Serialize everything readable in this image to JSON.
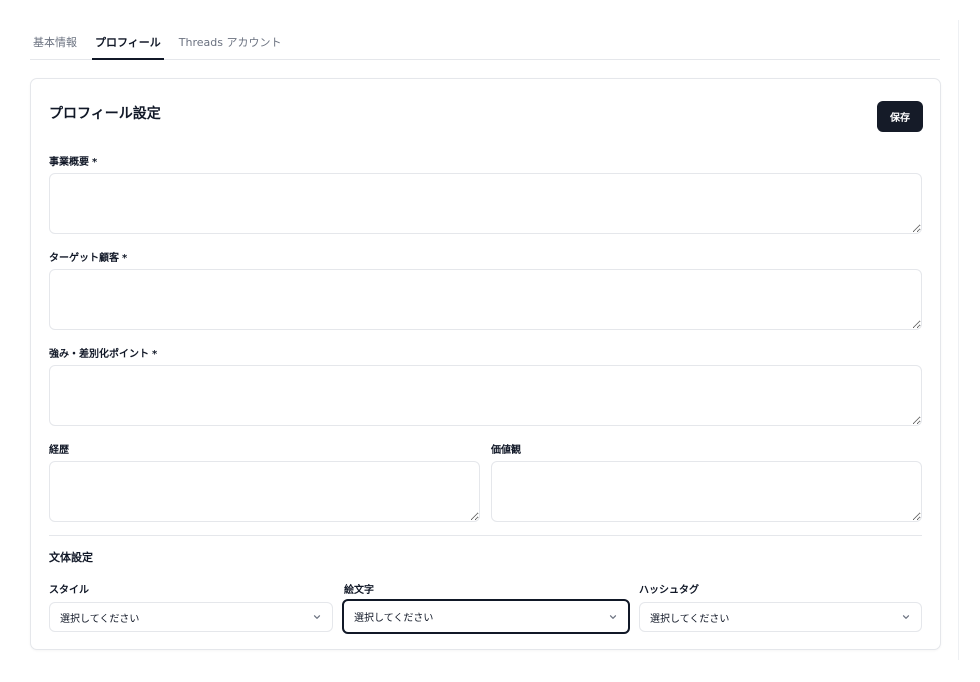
{
  "tabs": [
    {
      "label": "基本情報",
      "active": false
    },
    {
      "label": "プロフィール",
      "active": true
    },
    {
      "label": "Threads アカウント",
      "active": false
    }
  ],
  "profile": {
    "title": "プロフィール設定",
    "save_label": "保存",
    "required_mark": "*",
    "fields": {
      "business_overview": {
        "label": "事業概要",
        "value": ""
      },
      "target_customer": {
        "label": "ターゲット顧客",
        "value": ""
      },
      "strengths": {
        "label": "強み・差別化ポイント",
        "value": ""
      },
      "career": {
        "label": "経歴",
        "value": ""
      },
      "values": {
        "label": "価値観",
        "value": ""
      }
    }
  },
  "writing": {
    "title": "文体設定",
    "selects": {
      "style": {
        "label": "スタイル",
        "value": "選択してください"
      },
      "emoji": {
        "label": "絵文字",
        "value": "選択してください"
      },
      "hashtag": {
        "label": "ハッシュタグ",
        "value": "選択してください"
      }
    }
  },
  "icons": {
    "select_chevron": "chevron-down-icon"
  },
  "colors": {
    "primary_button": "#151b28",
    "border": "#e5e7eb",
    "text": "#111827",
    "muted": "#6b7280"
  }
}
